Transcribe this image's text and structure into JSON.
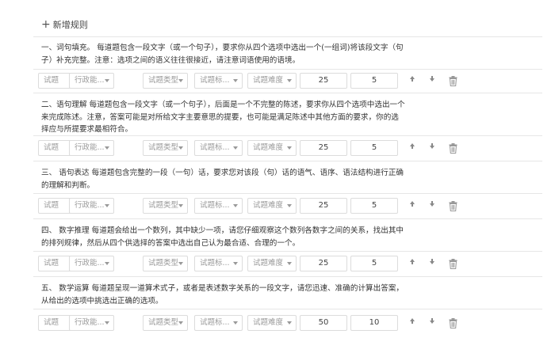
{
  "toolbar": {
    "add_label": "新增规则"
  },
  "rules": [
    {
      "desc": "一、词句填充。 每道题包含一段文字（或一个句子），要求你从四个选项中选出一个(一组词)将该段文字（句子）补充完整。注意：选项之间的语义往往很接近，请注意词语使用的语境。",
      "selects": [
        "试题",
        "行政能...",
        "试题类型",
        "试题标...",
        "试题难度"
      ],
      "count": "25",
      "score": "5"
    },
    {
      "desc": "二、语句理解 每道题包含一段文字（或一个句子），后面是一个不完整的陈述，要求你从四个选项中选出一个来完成陈述。注意，答案可能是对所给文字主要意思的提要，也可能是满足陈述中其他方面的要求，你的选择应与所提要求最相符合。",
      "selects": [
        "试题",
        "行政能...",
        "试题类型",
        "试题标...",
        "试题难度"
      ],
      "count": "25",
      "score": "5"
    },
    {
      "desc": "三、 语句表达 每道题包含完整的一段（一句）话，要求您对该段（句）话的语气、语序、语法结构进行正确的理解和判断。",
      "selects": [
        "试题",
        "行政能...",
        "试题类型",
        "试题标...",
        "试题难度"
      ],
      "count": "25",
      "score": "5"
    },
    {
      "desc": "四、 数字推理 每道题会给出一个数列，其中缺少一项，请您仔细观察这个数列各数字之间的关系，找出其中的排列规律，然后从四个供选择的答案中选出自己认为最合适、合理的一个。",
      "selects": [
        "试题",
        "行政能...",
        "试题类型",
        "试题标...",
        "试题难度"
      ],
      "count": "25",
      "score": "5"
    },
    {
      "desc": "五、 数学运算 每道题呈现一道算术式子，或者是表述数字关系的一段文字，请您迅速、准确的计算出答案，从给出的选项中挑选出正确的选项。",
      "selects": [
        "试题",
        "行政能...",
        "试题类型",
        "试题标...",
        "试题难度"
      ],
      "count": "50",
      "score": "10"
    }
  ]
}
